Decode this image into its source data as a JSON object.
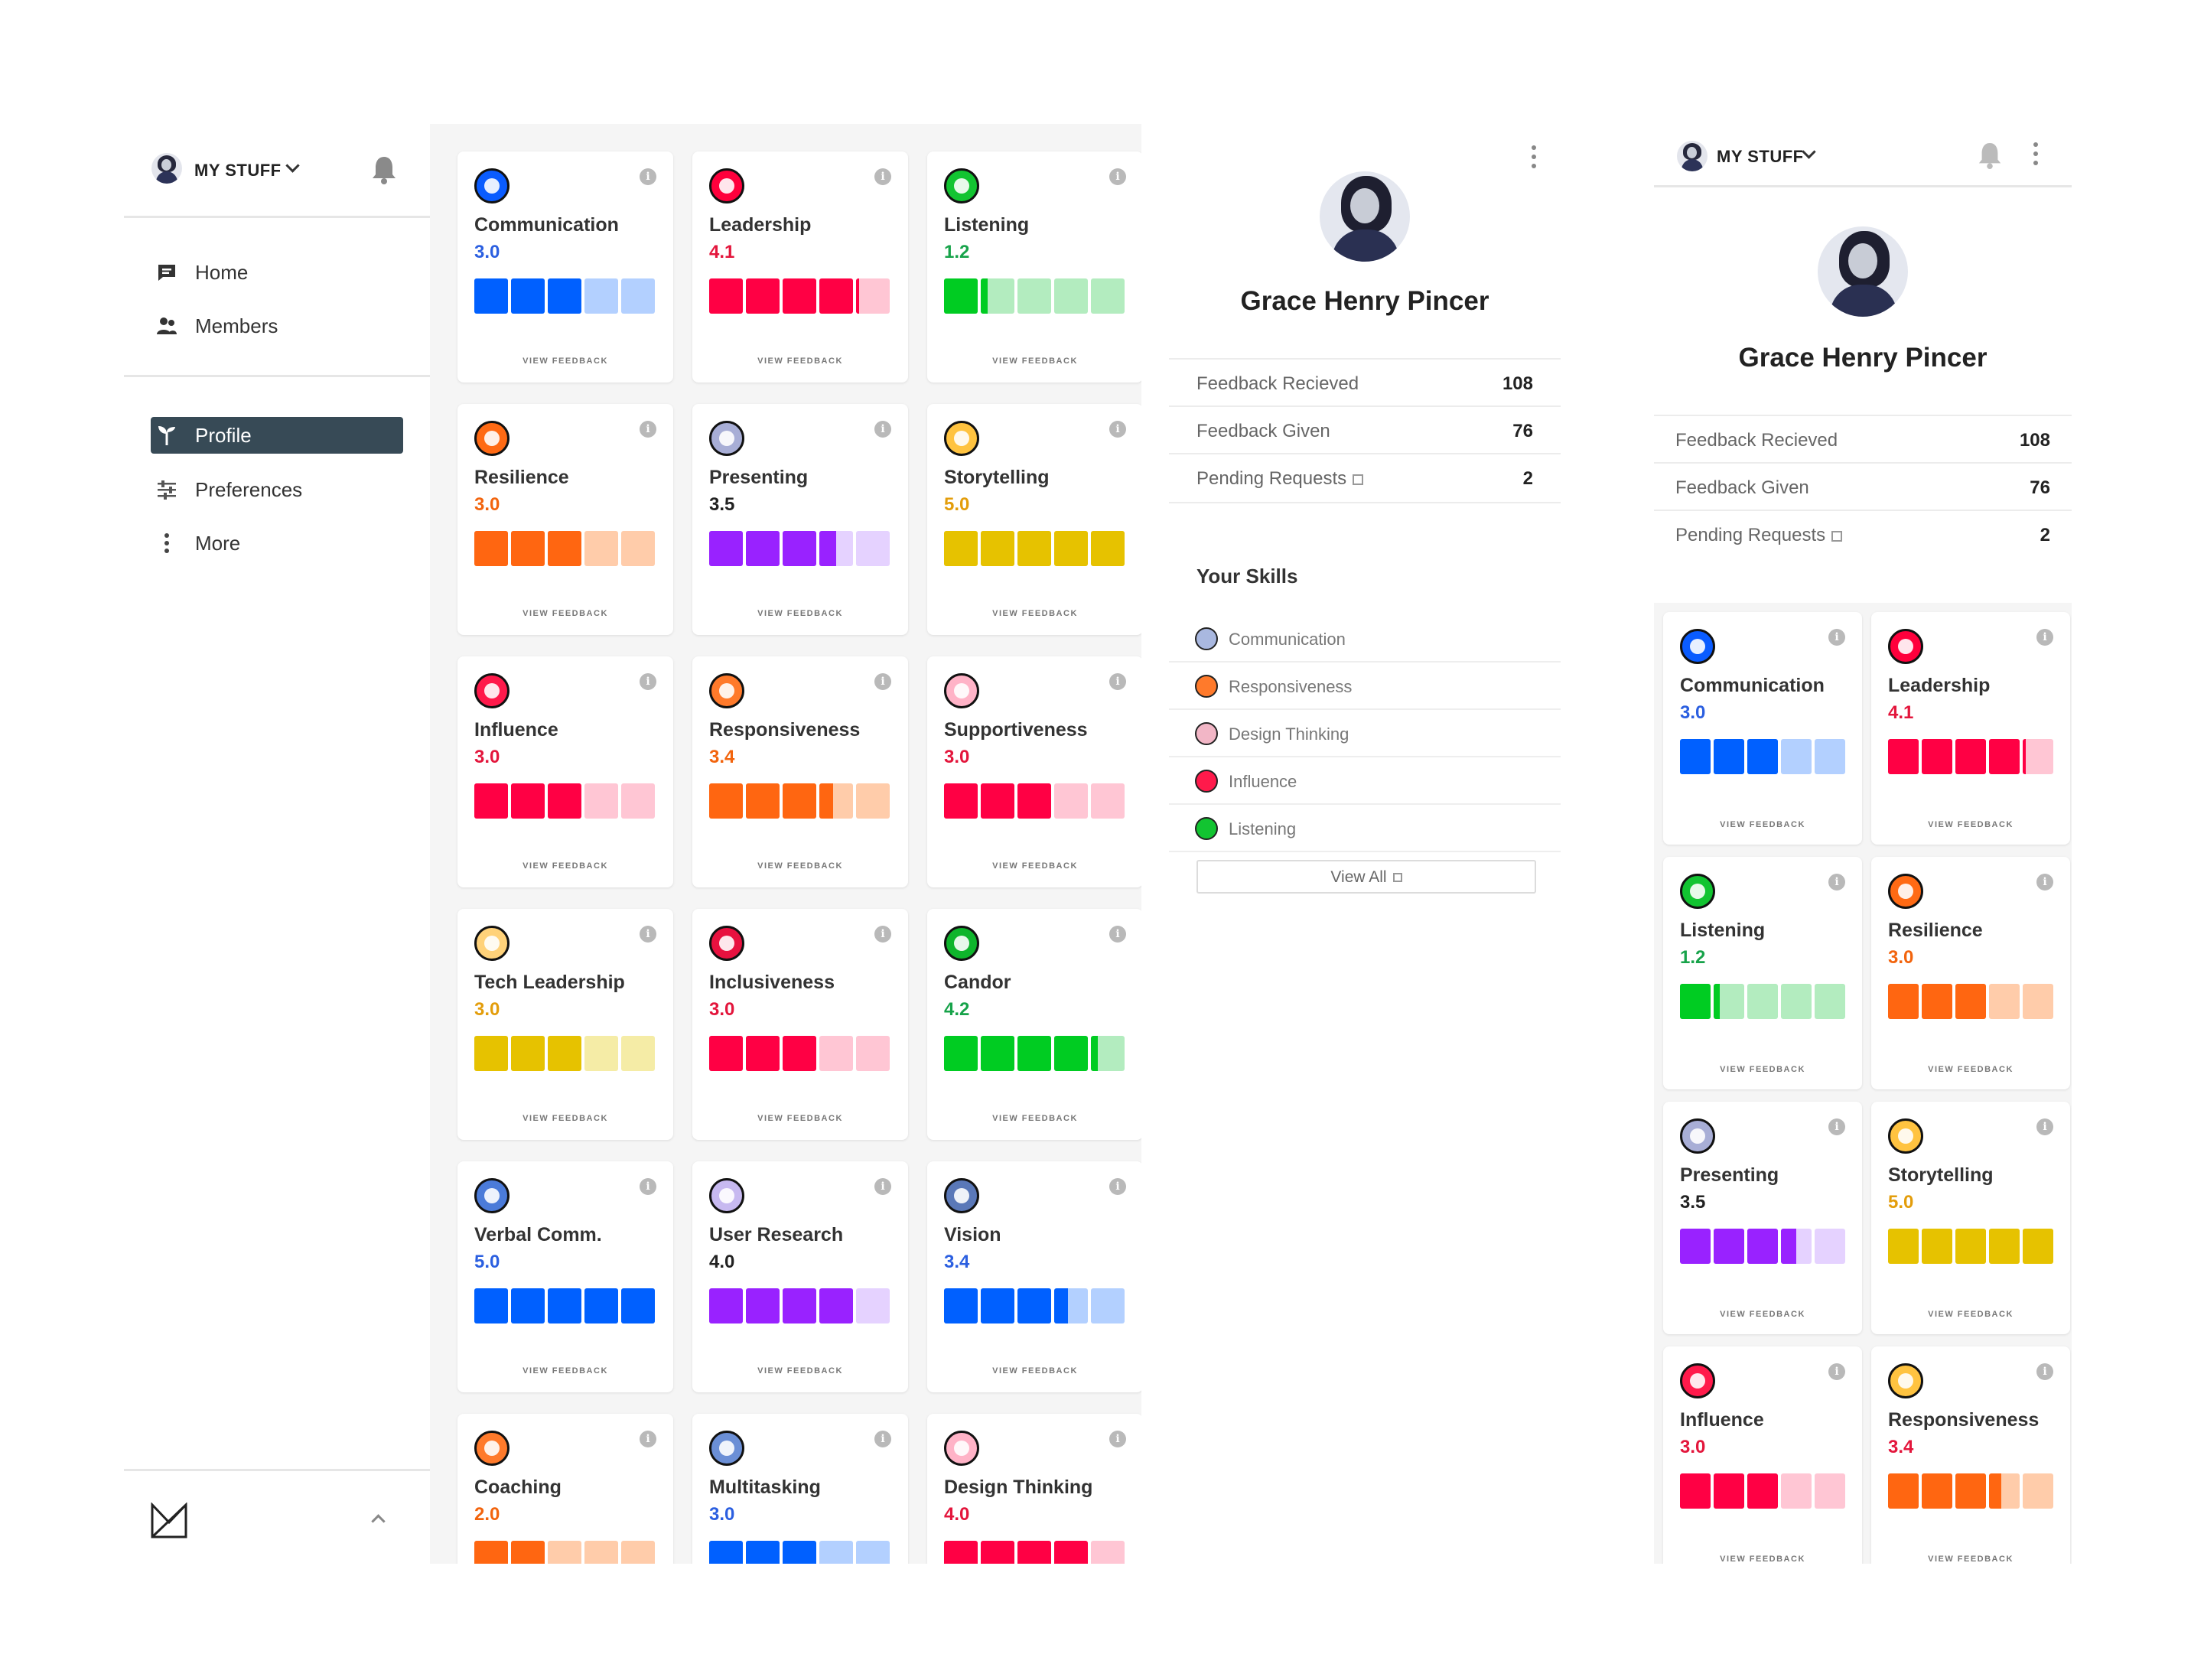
{
  "colors": {
    "blue": "#0060ff",
    "blue_light": "#b3d0ff",
    "red": "#ff0044",
    "red_light": "#ffc6d4",
    "green": "#00cc22",
    "green_light": "#b3ecbf",
    "orange": "#ff6611",
    "orange_light": "#ffccaa",
    "purple": "#9922ff",
    "purple_light": "#e5d2ff",
    "yellow": "#e6c200",
    "yellow_light": "#f5eca6",
    "nav_active": "#374a56"
  },
  "header": {
    "label": "MY STUFF",
    "avatar_icon": "user-avatar",
    "bell_icon": "bell-icon"
  },
  "nav": {
    "primary": [
      {
        "label": "Home",
        "icon": "chat-icon"
      },
      {
        "label": "Members",
        "icon": "people-icon"
      }
    ],
    "secondary": [
      {
        "label": "Profile",
        "icon": "sprout-icon",
        "active": true
      },
      {
        "label": "Preferences",
        "icon": "sliders-icon"
      },
      {
        "label": "More",
        "icon": "more-vertical-icon"
      }
    ]
  },
  "footer": {
    "logo": "M-logo",
    "collapse_icon": "chevron-up-icon"
  },
  "skills": [
    {
      "name": "Communication",
      "score": "3.0",
      "value": 3.0,
      "color": "blue",
      "score_color": "#2b5fe0",
      "icon": "speech-bubbles-icon",
      "icon_bg": "#0a5cff"
    },
    {
      "name": "Leadership",
      "score": "4.1",
      "value": 4.1,
      "color": "red",
      "score_color": "#e3163c",
      "icon": "flag-person-icon",
      "icon_bg": "#ff003c"
    },
    {
      "name": "Listening",
      "score": "1.2",
      "value": 1.2,
      "color": "green",
      "score_color": "#17a34a",
      "icon": "ear-icon",
      "icon_bg": "#12c431"
    },
    {
      "name": "Resilience",
      "score": "3.0",
      "value": 3.0,
      "color": "orange",
      "score_color": "#f2640d",
      "icon": "sun-icon",
      "icon_bg": "#ff6a14"
    },
    {
      "name": "Presenting",
      "score": "3.5",
      "value": 3.5,
      "color": "purple",
      "score_color": "#222222",
      "icon": "presenter-icon",
      "icon_bg": "#a8aed6"
    },
    {
      "name": "Storytelling",
      "score": "5.0",
      "value": 5.0,
      "color": "yellow",
      "score_color": "#e39d0b",
      "icon": "storyteller-icon",
      "icon_bg": "#ffc340"
    },
    {
      "name": "Influence",
      "score": "3.0",
      "value": 3.0,
      "color": "red",
      "score_color": "#e3163c",
      "icon": "magnet-icon",
      "icon_bg": "#ff1a4b"
    },
    {
      "name": "Responsiveness",
      "score": "3.4",
      "value": 3.4,
      "color": "orange",
      "score_color": "#f2640d",
      "icon": "signal-tower-icon",
      "icon_bg": "#ff7a2b"
    },
    {
      "name": "Supportiveness",
      "score": "3.0",
      "value": 3.0,
      "color": "red",
      "score_color": "#e3163c",
      "icon": "heart-hands-icon",
      "icon_bg": "#ffb3c7"
    },
    {
      "name": "Tech Leadership",
      "score": "3.0",
      "value": 3.0,
      "color": "yellow",
      "score_color": "#e39d0b",
      "icon": "lightbulb-icon",
      "icon_bg": "#ffd27a"
    },
    {
      "name": "Inclusiveness",
      "score": "3.0",
      "value": 3.0,
      "color": "red",
      "score_color": "#e3163c",
      "icon": "infinity-icon",
      "icon_bg": "#e8113f"
    },
    {
      "name": "Candor",
      "score": "4.2",
      "value": 4.2,
      "color": "green",
      "score_color": "#17a34a",
      "icon": "pacman-icon",
      "icon_bg": "#0fb52c"
    },
    {
      "name": "Verbal Comm.",
      "score": "5.0",
      "value": 5.0,
      "color": "blue",
      "score_color": "#2b5fe0",
      "icon": "microphone-icon",
      "icon_bg": "#4b7bd9"
    },
    {
      "name": "User Research",
      "score": "4.0",
      "value": 4.0,
      "color": "purple",
      "score_color": "#222222",
      "icon": "magnifier-icon",
      "icon_bg": "#c7b9f0"
    },
    {
      "name": "Vision",
      "score": "3.4",
      "value": 3.4,
      "color": "blue",
      "score_color": "#2b5fe0",
      "icon": "telescope-icon",
      "icon_bg": "#5a78b8"
    },
    {
      "name": "Coaching",
      "score": "2.0",
      "value": 2.0,
      "color": "orange",
      "score_color": "#f2640d",
      "icon": "megaphone-icon",
      "icon_bg": "#ff7a2b"
    },
    {
      "name": "Multitasking",
      "score": "3.0",
      "value": 3.0,
      "color": "blue",
      "score_color": "#2b5fe0",
      "icon": "juggle-icon",
      "icon_bg": "#6b8fd6"
    },
    {
      "name": "Design Thinking",
      "score": "4.0",
      "value": 4.0,
      "color": "red",
      "score_color": "#e3163c",
      "icon": "cube-pen-icon",
      "icon_bg": "#ffb3c7"
    }
  ],
  "view_feedback_label": "VIEW FEEDBACK",
  "profile": {
    "name": "Grace Henry Pincer",
    "menu_icon": "kebab-menu-icon",
    "stats": [
      {
        "label": "Feedback Recieved",
        "value": "108",
        "external": false
      },
      {
        "label": "Feedback Given",
        "value": "76",
        "external": false
      },
      {
        "label": "Pending Requests",
        "value": "2",
        "external": true
      }
    ],
    "your_skills_title": "Your Skills",
    "your_skills": [
      {
        "label": "Communication",
        "icon": "speech-bubbles-icon",
        "icon_bg": "#a9b8e0"
      },
      {
        "label": "Responsiveness",
        "icon": "signal-tower-icon",
        "icon_bg": "#ff7a2b"
      },
      {
        "label": "Design Thinking",
        "icon": "cube-pen-icon",
        "icon_bg": "#f2b6c6"
      },
      {
        "label": "Influence",
        "icon": "magnet-icon",
        "icon_bg": "#ff1a4b"
      },
      {
        "label": "Listening",
        "icon": "ear-icon",
        "icon_bg": "#12c431"
      }
    ],
    "view_all_label": "View All"
  },
  "mobile": {
    "header_label": "MY STUFF",
    "skills": [
      {
        "name": "Communication",
        "score": "3.0",
        "value": 3.0,
        "color": "blue",
        "score_color": "#2b5fe0",
        "icon": "speech-bubbles-icon",
        "icon_bg": "#0a5cff"
      },
      {
        "name": "Leadership",
        "score": "4.1",
        "value": 4.1,
        "color": "red",
        "score_color": "#e3163c",
        "icon": "flag-person-icon",
        "icon_bg": "#ff003c"
      },
      {
        "name": "Listening",
        "score": "1.2",
        "value": 1.2,
        "color": "green",
        "score_color": "#17a34a",
        "icon": "ear-icon",
        "icon_bg": "#12c431"
      },
      {
        "name": "Resilience",
        "score": "3.0",
        "value": 3.0,
        "color": "orange",
        "score_color": "#f2640d",
        "icon": "sun-icon",
        "icon_bg": "#ff6a14"
      },
      {
        "name": "Presenting",
        "score": "3.5",
        "value": 3.5,
        "color": "purple",
        "score_color": "#222222",
        "icon": "presenter-icon",
        "icon_bg": "#a8aed6"
      },
      {
        "name": "Storytelling",
        "score": "5.0",
        "value": 5.0,
        "color": "yellow",
        "score_color": "#e39d0b",
        "icon": "storyteller-icon",
        "icon_bg": "#ffc340"
      },
      {
        "name": "Influence",
        "score": "3.0",
        "value": 3.0,
        "color": "red",
        "score_color": "#e3163c",
        "icon": "magnet-icon",
        "icon_bg": "#ff1a4b"
      },
      {
        "name": "Responsiveness",
        "score": "3.4",
        "value": 3.4,
        "color": "orange",
        "score_color": "#e3163c",
        "icon": "storyteller-icon",
        "icon_bg": "#ffc340"
      }
    ]
  }
}
